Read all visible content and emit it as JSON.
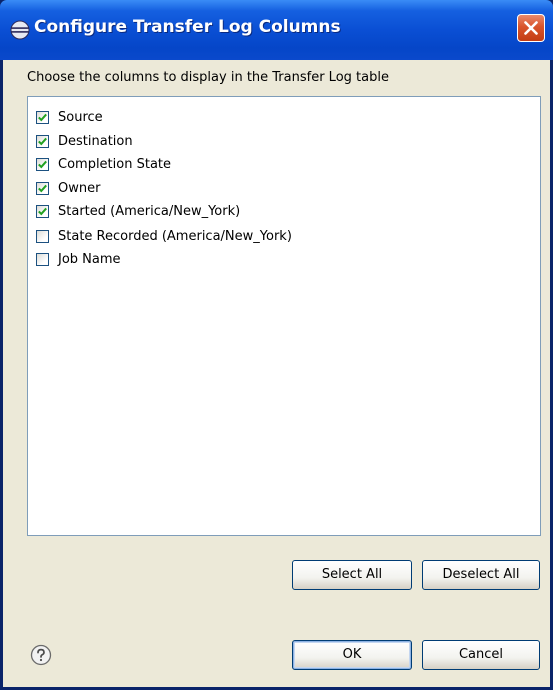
{
  "window": {
    "title": "Configure Transfer Log Columns"
  },
  "dialog": {
    "instruction": "Choose the columns to display in the Transfer Log table",
    "columns": [
      {
        "label": "Source",
        "checked": true
      },
      {
        "label": "Destination",
        "checked": true
      },
      {
        "label": "Completion State",
        "checked": true
      },
      {
        "label": "Owner",
        "checked": true
      },
      {
        "label": "Started (America/New_York)",
        "checked": true
      },
      {
        "label": "State Recorded (America/New_York)",
        "checked": false
      },
      {
        "label": "Job Name",
        "checked": false
      }
    ],
    "select_all_label": "Select All",
    "deselect_all_label": "Deselect All",
    "ok_label": "OK",
    "cancel_label": "Cancel"
  },
  "icons": {
    "title": "eclipse-icon",
    "close": "close-icon",
    "help": "help-icon",
    "check": "checkmark-icon"
  },
  "colors": {
    "titlebar": "#0a4fd4",
    "close_button": "#d9542b",
    "dialog_bg": "#ece9d8",
    "check_mark": "#21a121",
    "list_border": "#7f9db9"
  }
}
